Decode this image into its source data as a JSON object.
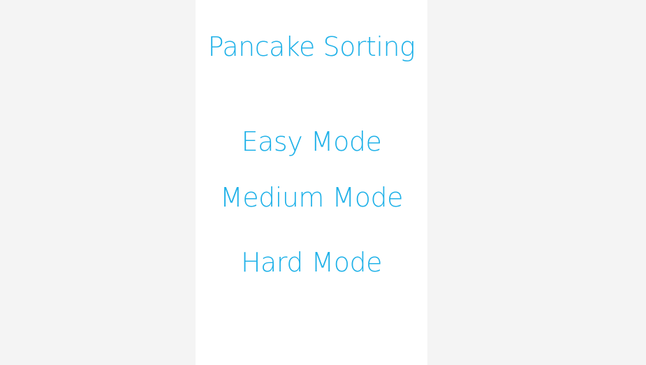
{
  "app": {
    "title": "Pancake Sorting"
  },
  "menu": {
    "items": [
      {
        "label": "Easy Mode"
      },
      {
        "label": "Medium Mode"
      },
      {
        "label": "Hard Mode"
      }
    ]
  },
  "colors": {
    "background": "#f4f4f4",
    "panel": "#ffffff",
    "accent": "#1fb1e8"
  }
}
